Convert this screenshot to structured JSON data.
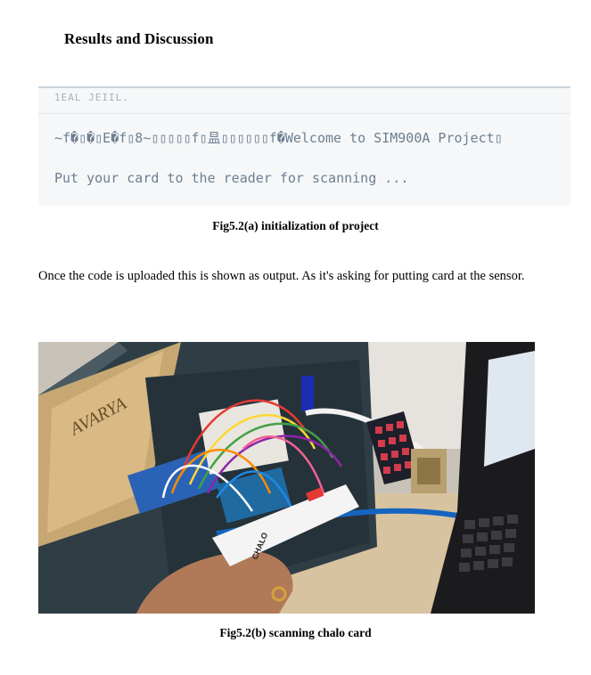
{
  "heading": "Results and Discussion",
  "serial_monitor": {
    "line0": "1EAL JEIIL.",
    "line1": "~f�▯�▯E�f▯8~▯▯▯▯▯f▯昷▯▯▯▯▯▯f�Welcome to SIM900A Project▯",
    "line2": "Put your card to the reader for scanning ..."
  },
  "caption_a": "Fig5.2(a) initialization of project",
  "paragraph": "Once the code is uploaded this is shown as output. As it's asking for putting  card at the sensor.",
  "photo": {
    "box_brand": "AVARYA",
    "card_text": "CHALO"
  },
  "caption_b": "Fig5.2(b) scanning chalo card"
}
